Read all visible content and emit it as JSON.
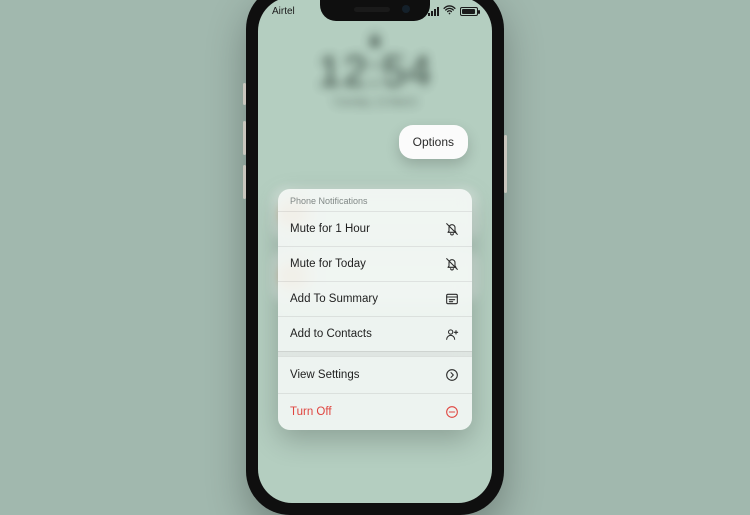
{
  "statusbar": {
    "carrier": "Airtel"
  },
  "lockscreen": {
    "time": "12:54",
    "date": "Tuesday, 13 March"
  },
  "options_pill": {
    "label": "Options"
  },
  "sheet": {
    "header": "Phone Notifications",
    "items": {
      "mute_hour": {
        "label": "Mute for 1 Hour"
      },
      "mute_today": {
        "label": "Mute for Today"
      },
      "summary": {
        "label": "Add To Summary"
      },
      "contacts": {
        "label": "Add to Contacts"
      },
      "settings": {
        "label": "View Settings"
      },
      "turn_off": {
        "label": "Turn Off"
      }
    }
  },
  "colors": {
    "destructive": "#e0443f"
  }
}
